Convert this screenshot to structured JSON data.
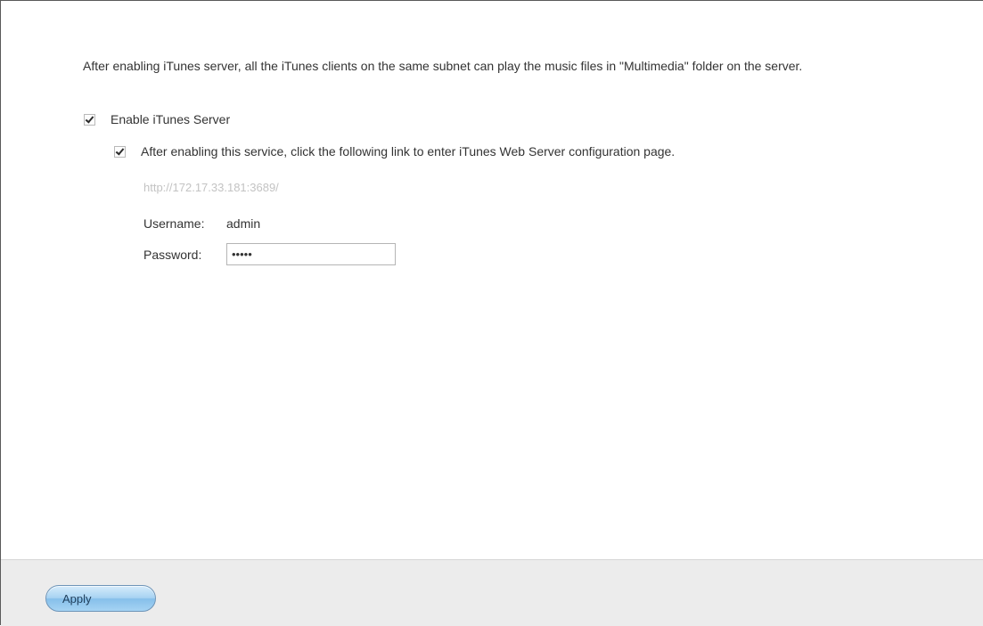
{
  "description": "After enabling iTunes server, all the iTunes clients on the same subnet can play the music files in \"Multimedia\" folder on the server.",
  "enable_itunes_server": {
    "label": "Enable iTunes Server",
    "checked": true
  },
  "web_config": {
    "label": "After enabling this service, click the following link to enter iTunes Web Server configuration page.",
    "checked": true,
    "link": "http://172.17.33.181:3689/"
  },
  "credentials": {
    "username_label": "Username:",
    "username_value": "admin",
    "password_label": "Password:",
    "password_value": "•••••"
  },
  "footer": {
    "apply_label": "Apply"
  }
}
